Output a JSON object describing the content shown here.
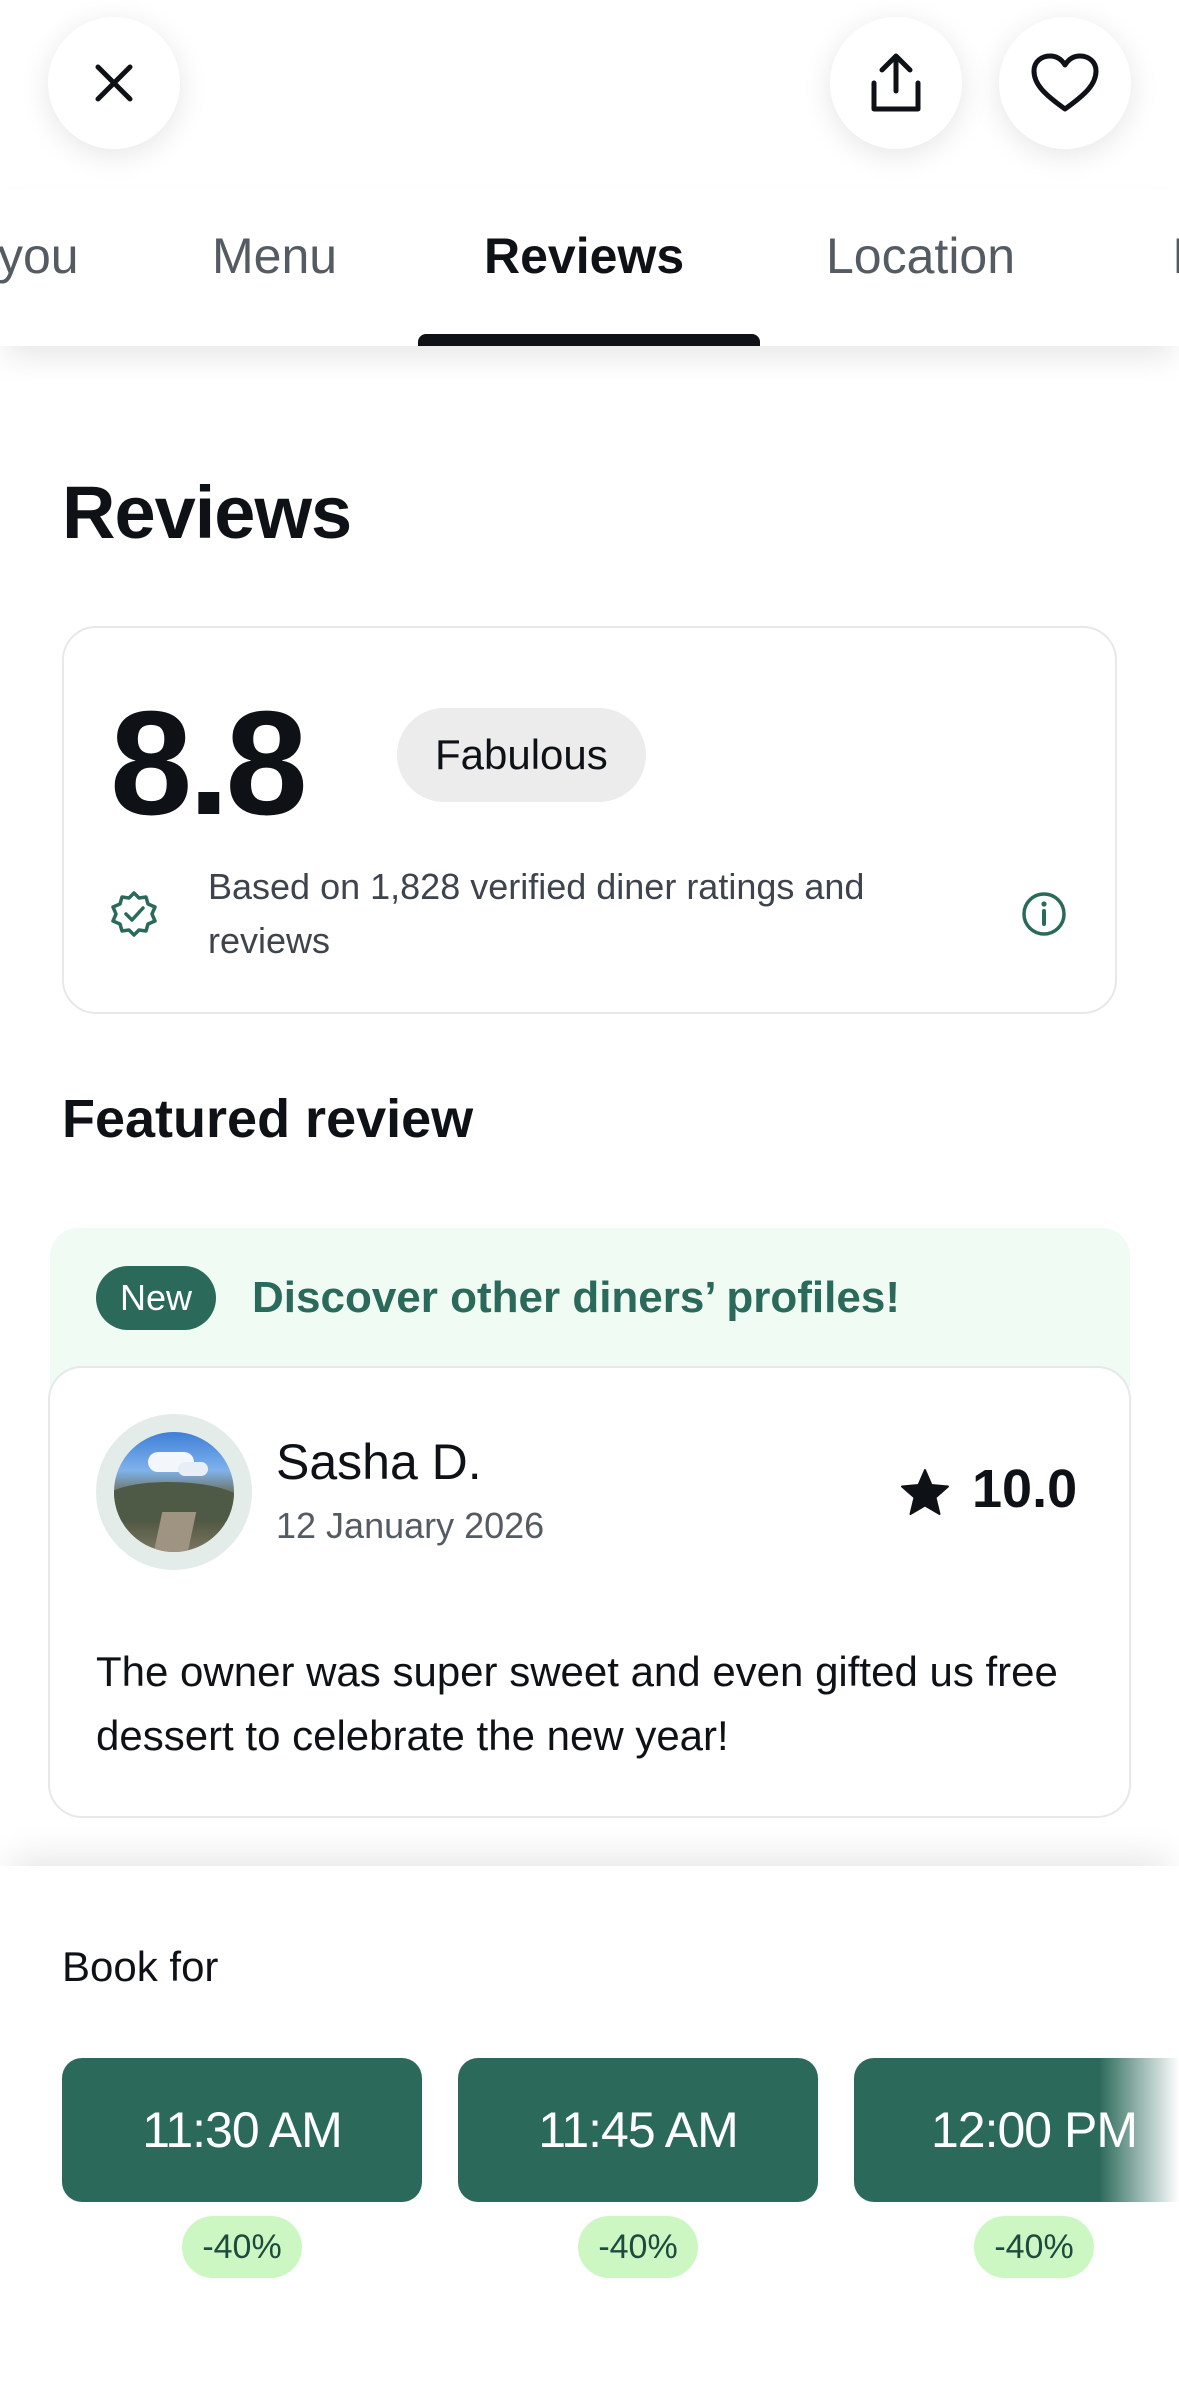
{
  "header": {
    "close_icon": "close-icon",
    "share_icon": "share-icon",
    "favorite_icon": "heart-icon"
  },
  "tabs": [
    {
      "label": "you",
      "active": false
    },
    {
      "label": "Menu",
      "active": false
    },
    {
      "label": "Reviews",
      "active": true
    },
    {
      "label": "Location",
      "active": false
    },
    {
      "label": "I",
      "active": false
    }
  ],
  "reviews": {
    "title": "Reviews",
    "score": "8.8",
    "rating_label": "Fabulous",
    "note": "Based on 1,828 verified diner ratings and reviews"
  },
  "featured": {
    "title": "Featured review",
    "badge": "New",
    "promo": "Discover other diners’ profiles!",
    "review": {
      "name": "Sasha D.",
      "date": "12 January 2026",
      "score": "10.0",
      "text": "The owner was super sweet and even gifted us free dessert to celebrate the new year!"
    }
  },
  "booking": {
    "label": "Book for",
    "slots": [
      {
        "time": "11:30 AM",
        "discount": "-40%"
      },
      {
        "time": "11:45 AM",
        "discount": "-40%"
      },
      {
        "time": "12:00 PM",
        "discount": "-40%"
      }
    ]
  },
  "colors": {
    "brand_green": "#2b6a5b",
    "promo_bg": "#f0fbf4",
    "discount_bg": "#ccf7c2"
  }
}
